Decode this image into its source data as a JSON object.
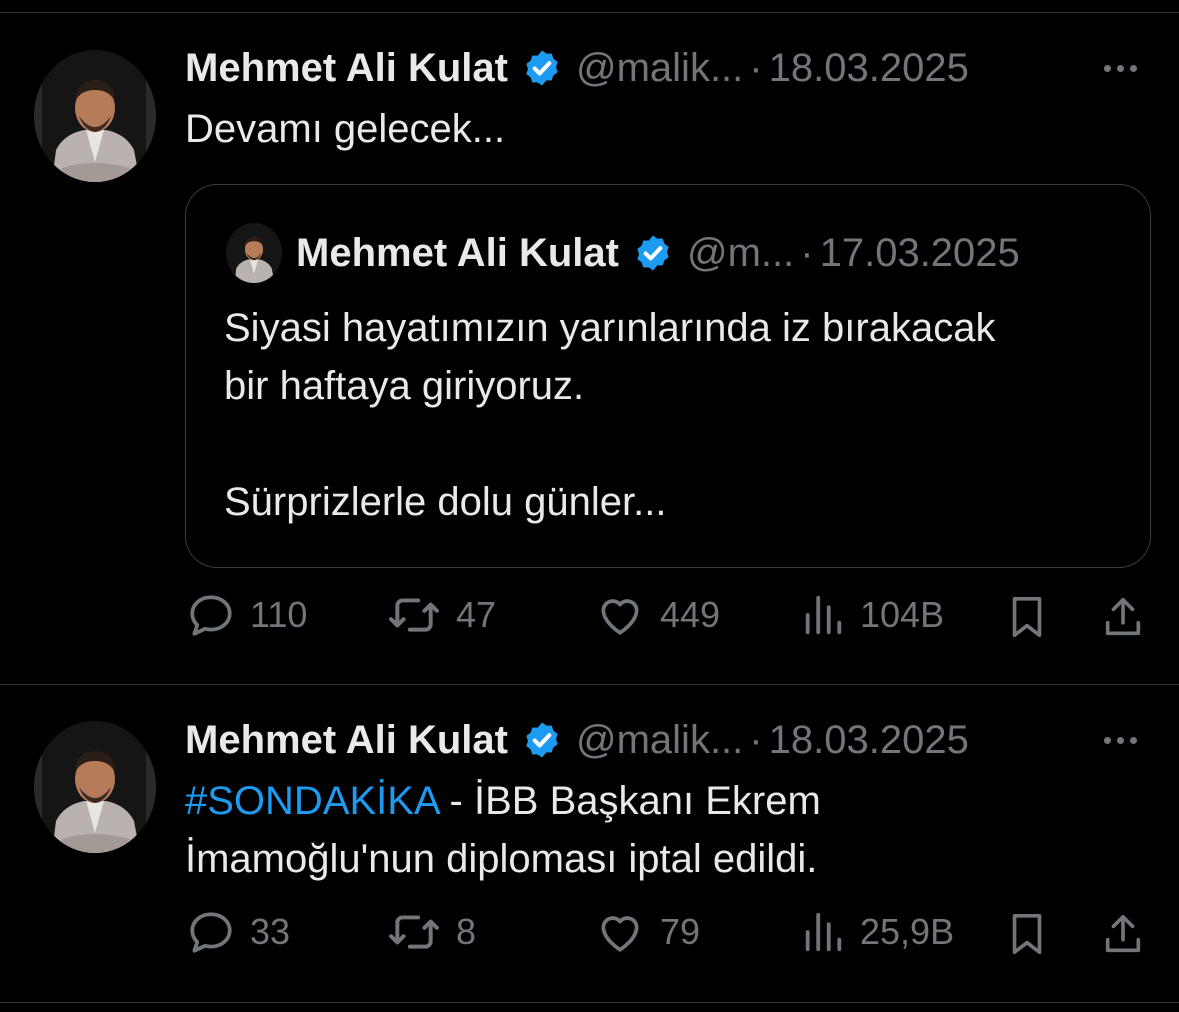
{
  "colors": {
    "accent": "#1d9bf0",
    "muted": "#71767b",
    "text": "#e7e9ea",
    "background": "#000000"
  },
  "tweets": [
    {
      "author": "Mehmet Ali Kulat",
      "handle": "@malik...",
      "separator": "·",
      "date": "18.03.2025",
      "text": "Devamı gelecek...",
      "quote": {
        "author": "Mehmet Ali Kulat",
        "handle": "@m...",
        "separator": "·",
        "date": "17.03.2025",
        "lines": [
          "Siyasi hayatımızın yarınlarında iz bırakacak",
          "bir haftaya giriyoruz.",
          "Sürprizlerle dolu günler..."
        ]
      },
      "actions": {
        "replies": "110",
        "reposts": "47",
        "likes": "449",
        "views": "104B"
      }
    },
    {
      "author": "Mehmet Ali Kulat",
      "handle": "@malik...",
      "separator": "·",
      "date": "18.03.2025",
      "hashtag": "#SONDAKİKA",
      "text_line1": " - İBB Başkanı Ekrem",
      "text_line2": "İmamoğlu'nun diploması iptal edildi.",
      "actions": {
        "replies": "33",
        "reposts": "8",
        "likes": "79",
        "views": "25,9B"
      }
    }
  ]
}
